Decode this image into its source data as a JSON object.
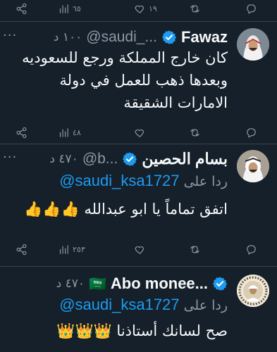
{
  "top_actions": {
    "likes": "٦٥",
    "retweets": "",
    "replies": "١٩"
  },
  "tweets": [
    {
      "name": "Fawaz",
      "handle": "@saudi_...",
      "time": "١٠٠ د",
      "text": "كان خارج المملكة ورجع للسعوديه وبعدها ذهب للعمل في دولة الامارات الشقيقة",
      "actions": {
        "views": "",
        "likes": "٤٨",
        "retweets": "",
        "replies": ""
      }
    },
    {
      "name": "بسام الحصين",
      "handle": "@b...",
      "time": "٤٧٠ د",
      "reply_label": "ردا على",
      "reply_to": "@saudi_ksa1727",
      "text": "اتفق تماماً يا ابو عبدالله 👍👍👍",
      "actions": {
        "views": "",
        "likes": "٢٥٣",
        "retweets": "",
        "replies": ""
      }
    },
    {
      "name": "Abo monee...",
      "flag": "🇸🇦",
      "time": "٤٧٠ د",
      "reply_label": "ردا على",
      "reply_to": "@saudi_ksa1727",
      "text": "صح لسانك أستاذنا 👑👑👑"
    }
  ],
  "colors": {
    "background": "#15202b",
    "accent": "#1d9bf0",
    "muted": "#8b98a5",
    "divider": "#38444d"
  }
}
